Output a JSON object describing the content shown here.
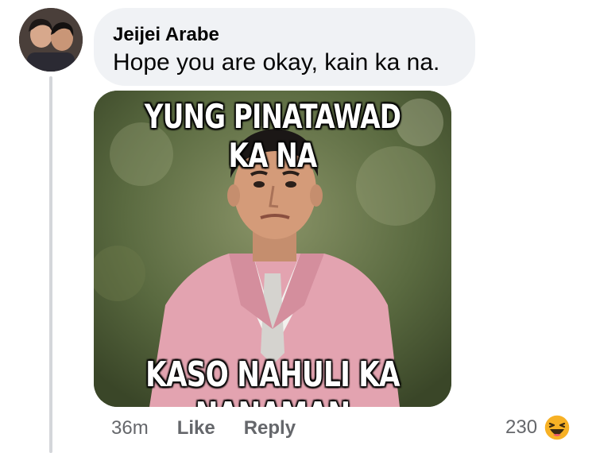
{
  "comment": {
    "author": "Jeijei Arabe",
    "text": "Hope you are okay, kain ka na.",
    "meme": {
      "caption_top": "YUNG PINATAWAD KA NA",
      "caption_bottom": "KASO NAHULI KA NANAMAN"
    },
    "time": "36m",
    "like_label": "Like",
    "reply_label": "Reply",
    "reaction_count": "230",
    "reaction_icon": "haha-icon"
  },
  "colors": {
    "bubble": "#f0f2f5",
    "meta_text": "#65676b",
    "suit": "#e3a3b0",
    "haha": "#f7b125"
  }
}
